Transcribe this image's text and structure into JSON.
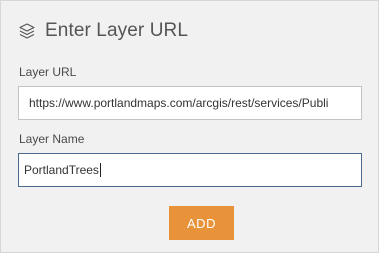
{
  "header": {
    "icon": "layers-icon",
    "title": "Enter Layer URL"
  },
  "form": {
    "layer_url": {
      "label": "Layer URL",
      "value": "https://www.portlandmaps.com/arcgis/rest/services/Publi"
    },
    "layer_name": {
      "label": "Layer Name",
      "value": "PortlandTrees"
    },
    "add_button": {
      "label": "ADD"
    }
  },
  "colors": {
    "panel_background": "#f1f1f1",
    "accent_button": "#e8933a",
    "focus_border": "#4b6b8e"
  }
}
